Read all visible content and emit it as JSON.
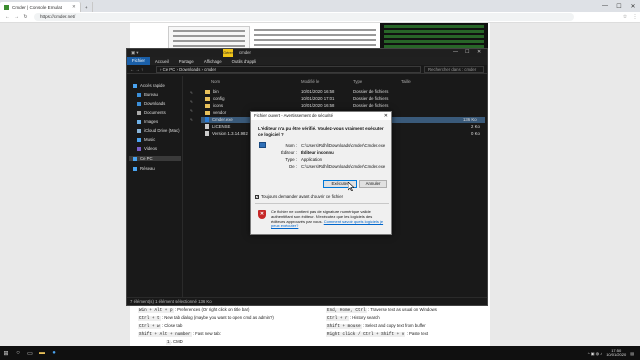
{
  "browser": {
    "tab_title": "Cmder | Console Emulat",
    "url": "https://cmder.net/",
    "window_controls": [
      "—",
      "☐",
      "✕"
    ]
  },
  "explorer": {
    "app_label": "Gérer",
    "title_suffix": "cmder",
    "menu": [
      "Fichier",
      "Accueil",
      "Partage",
      "Affichage",
      "Outils d'appli"
    ],
    "path": "› Ce PC › Downloads › cmder",
    "search_placeholder": "Rechercher dans : cmder",
    "nav": [
      "Accès rapide",
      "Bureau",
      "Downloads",
      "Documents",
      "Images",
      "iCloud Drive (Mac)",
      "Music",
      "Videos",
      "Ce PC",
      "Réseau"
    ],
    "columns": [
      "Nom",
      "Modifié le",
      "Type",
      "Taille"
    ],
    "files": [
      {
        "name": "bin",
        "date": "10/01/2020 16:58",
        "type": "Dossier de fichiers",
        "size": ""
      },
      {
        "name": "config",
        "date": "10/01/2020 17:01",
        "type": "Dossier de fichiers",
        "size": ""
      },
      {
        "name": "icons",
        "date": "10/01/2020 16:58",
        "type": "Dossier de fichiers",
        "size": ""
      },
      {
        "name": "vendor",
        "date": "",
        "type": "",
        "size": ""
      },
      {
        "name": "Cmder.exe",
        "date": "",
        "type": "",
        "size": "136 Ko"
      },
      {
        "name": "LICENSE",
        "date": "",
        "type": "",
        "size": "2 Ko"
      },
      {
        "name": "Version 1.3.14.982",
        "date": "",
        "type": "",
        "size": "0 Ko"
      }
    ],
    "status": "7 élément(s)   1 élément sélectionné  136 Ko"
  },
  "dialog": {
    "title": "Fichier ouvert - Avertissement de sécurité",
    "question": "L'éditeur n'a pu être vérifié. Voulez-vous vraiment exécuter ce logiciel ?",
    "fields": [
      {
        "k": "Nom :",
        "v": "C:\\Users\\Rdhl\\Downloads\\cmder\\Cmder.exe"
      },
      {
        "k": "Éditeur :",
        "v": "Éditeur inconnu"
      },
      {
        "k": "Type :",
        "v": "Application"
      },
      {
        "k": "De :",
        "v": "C:\\Users\\Rdhl\\Downloads\\cmder\\Cmder.exe"
      }
    ],
    "run_label": "Exécuter",
    "cancel_label": "Annuler",
    "checkbox_label": "Toujours demander avant d'ouvrir ce fichier",
    "checkbox_checked": true,
    "warning": "Ce fichier ne contient pas de signature numérique valide authentifiant son éditeur. N'exécutez que les logiciels des éditeurs approuvés par vous.",
    "warning_link": "Comment savoir quels logiciels je peux exécuter?"
  },
  "shortcuts": {
    "left": [
      {
        "key": "Win + Alt + p",
        "text": ": Preferences (Or right click on title bar)"
      },
      {
        "key": "Ctrl + t",
        "text": ": New tab dialog (maybe you want to open cmd as admin?)"
      },
      {
        "key": "Ctrl + w",
        "text": ": Close tab"
      },
      {
        "key": "Shift + Alt + number",
        "text": ": Fast new tab:"
      },
      {
        "key": "1",
        "text": ". CMD"
      }
    ],
    "right": [
      {
        "key": "End, Home, Ctrl",
        "text": ": Traverse text as usual on Windows"
      },
      {
        "key": "Ctrl + r",
        "text": ": History search"
      },
      {
        "key": "Shift + mouse",
        "text": ": Select and copy text from buffer"
      },
      {
        "key": "Right click / Ctrl + Shift + v",
        "text": ": Paste text"
      }
    ]
  },
  "taskbar": {
    "time": "17:50",
    "date": "10/01/2020"
  },
  "colors": {
    "accent": "#0078d7",
    "explorer_bg": "#191919",
    "file_tab": "#1a5fa8"
  }
}
